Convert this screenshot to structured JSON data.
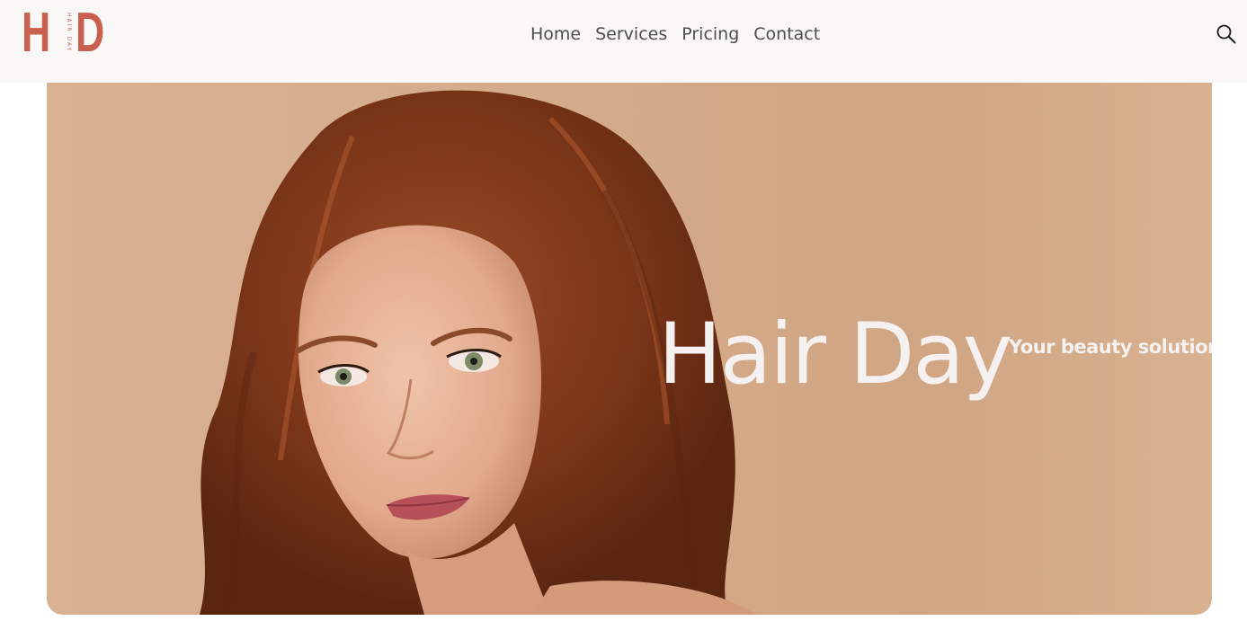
{
  "brand": {
    "logo_text": "HD",
    "logo_subtext": "HAIR DAY",
    "logo_color": "#c9604f"
  },
  "nav": {
    "items": [
      {
        "label": "Home"
      },
      {
        "label": "Services"
      },
      {
        "label": "Pricing"
      },
      {
        "label": "Contact"
      }
    ]
  },
  "header": {
    "search_icon": "search-icon",
    "background": "#f9f8f6"
  },
  "hero": {
    "title": "Hair Day",
    "subtitle": "Your beauty solution",
    "image": "woman-portrait-photo",
    "background_color": "#d4ac8c",
    "text_color": "#f4f1f0"
  }
}
